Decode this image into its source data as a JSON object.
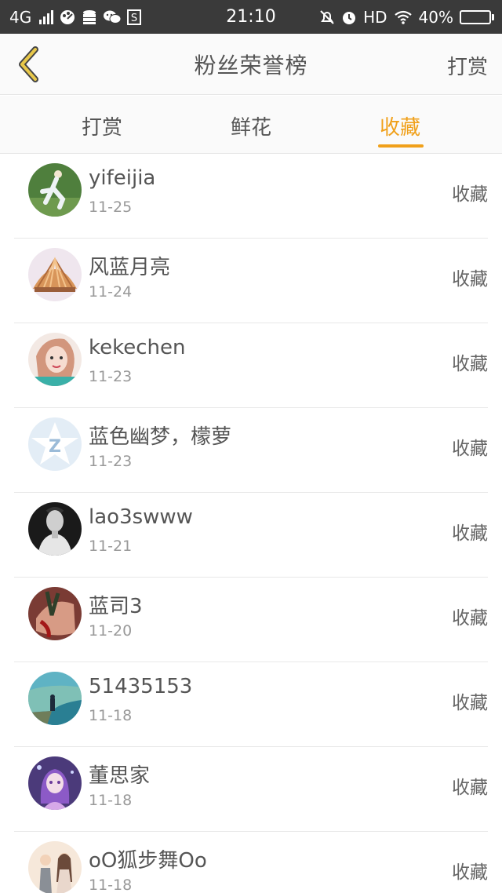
{
  "status_bar": {
    "network": "4G",
    "time": "21:10",
    "hd": "HD",
    "battery": "40%",
    "icons": [
      "signal-icon",
      "paint-icon",
      "database-icon",
      "wechat-icon",
      "s-icon",
      "mute-bell-icon",
      "alarm-icon",
      "wifi-icon",
      "battery-icon"
    ]
  },
  "header": {
    "title": "粉丝荣誉榜",
    "action": "打赏"
  },
  "tabs": [
    {
      "label": "打赏"
    },
    {
      "label": "鲜花"
    },
    {
      "label": "收藏"
    }
  ],
  "active_tab": "收藏",
  "accent_color": "#f0a01a",
  "fans": [
    {
      "name": "yifeijia",
      "date": "11-25",
      "action": "收藏"
    },
    {
      "name": "风蓝月亮",
      "date": "11-24",
      "action": "收藏"
    },
    {
      "name": "kekechen",
      "date": "11-23",
      "action": "收藏"
    },
    {
      "name": "蓝色幽梦，檬萝",
      "date": "11-23",
      "action": "收藏"
    },
    {
      "name": "lao3swww",
      "date": "11-21",
      "action": "收藏"
    },
    {
      "name": "蓝司3",
      "date": "11-20",
      "action": "收藏"
    },
    {
      "name": "51435153",
      "date": "11-18",
      "action": "收藏"
    },
    {
      "name": "董思家",
      "date": "11-18",
      "action": "收藏"
    },
    {
      "name": "oO狐步舞Oo",
      "date": "11-18",
      "action": "收藏"
    }
  ]
}
